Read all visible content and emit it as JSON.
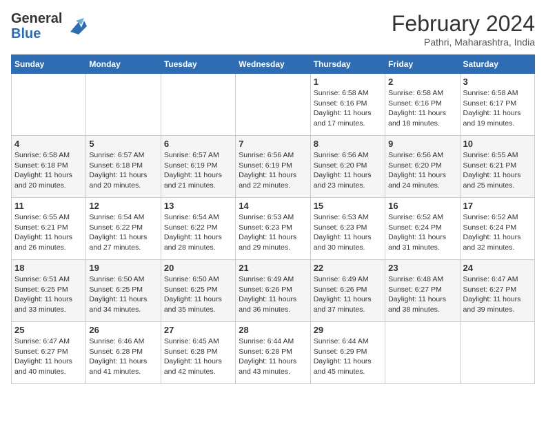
{
  "header": {
    "logo_general": "General",
    "logo_blue": "Blue",
    "month_year": "February 2024",
    "location": "Pathri, Maharashtra, India"
  },
  "days_of_week": [
    "Sunday",
    "Monday",
    "Tuesday",
    "Wednesday",
    "Thursday",
    "Friday",
    "Saturday"
  ],
  "weeks": [
    [
      {
        "num": "",
        "info": ""
      },
      {
        "num": "",
        "info": ""
      },
      {
        "num": "",
        "info": ""
      },
      {
        "num": "",
        "info": ""
      },
      {
        "num": "1",
        "info": "Sunrise: 6:58 AM\nSunset: 6:16 PM\nDaylight: 11 hours and 17 minutes."
      },
      {
        "num": "2",
        "info": "Sunrise: 6:58 AM\nSunset: 6:16 PM\nDaylight: 11 hours and 18 minutes."
      },
      {
        "num": "3",
        "info": "Sunrise: 6:58 AM\nSunset: 6:17 PM\nDaylight: 11 hours and 19 minutes."
      }
    ],
    [
      {
        "num": "4",
        "info": "Sunrise: 6:58 AM\nSunset: 6:18 PM\nDaylight: 11 hours and 20 minutes."
      },
      {
        "num": "5",
        "info": "Sunrise: 6:57 AM\nSunset: 6:18 PM\nDaylight: 11 hours and 20 minutes."
      },
      {
        "num": "6",
        "info": "Sunrise: 6:57 AM\nSunset: 6:19 PM\nDaylight: 11 hours and 21 minutes."
      },
      {
        "num": "7",
        "info": "Sunrise: 6:56 AM\nSunset: 6:19 PM\nDaylight: 11 hours and 22 minutes."
      },
      {
        "num": "8",
        "info": "Sunrise: 6:56 AM\nSunset: 6:20 PM\nDaylight: 11 hours and 23 minutes."
      },
      {
        "num": "9",
        "info": "Sunrise: 6:56 AM\nSunset: 6:20 PM\nDaylight: 11 hours and 24 minutes."
      },
      {
        "num": "10",
        "info": "Sunrise: 6:55 AM\nSunset: 6:21 PM\nDaylight: 11 hours and 25 minutes."
      }
    ],
    [
      {
        "num": "11",
        "info": "Sunrise: 6:55 AM\nSunset: 6:21 PM\nDaylight: 11 hours and 26 minutes."
      },
      {
        "num": "12",
        "info": "Sunrise: 6:54 AM\nSunset: 6:22 PM\nDaylight: 11 hours and 27 minutes."
      },
      {
        "num": "13",
        "info": "Sunrise: 6:54 AM\nSunset: 6:22 PM\nDaylight: 11 hours and 28 minutes."
      },
      {
        "num": "14",
        "info": "Sunrise: 6:53 AM\nSunset: 6:23 PM\nDaylight: 11 hours and 29 minutes."
      },
      {
        "num": "15",
        "info": "Sunrise: 6:53 AM\nSunset: 6:23 PM\nDaylight: 11 hours and 30 minutes."
      },
      {
        "num": "16",
        "info": "Sunrise: 6:52 AM\nSunset: 6:24 PM\nDaylight: 11 hours and 31 minutes."
      },
      {
        "num": "17",
        "info": "Sunrise: 6:52 AM\nSunset: 6:24 PM\nDaylight: 11 hours and 32 minutes."
      }
    ],
    [
      {
        "num": "18",
        "info": "Sunrise: 6:51 AM\nSunset: 6:25 PM\nDaylight: 11 hours and 33 minutes."
      },
      {
        "num": "19",
        "info": "Sunrise: 6:50 AM\nSunset: 6:25 PM\nDaylight: 11 hours and 34 minutes."
      },
      {
        "num": "20",
        "info": "Sunrise: 6:50 AM\nSunset: 6:25 PM\nDaylight: 11 hours and 35 minutes."
      },
      {
        "num": "21",
        "info": "Sunrise: 6:49 AM\nSunset: 6:26 PM\nDaylight: 11 hours and 36 minutes."
      },
      {
        "num": "22",
        "info": "Sunrise: 6:49 AM\nSunset: 6:26 PM\nDaylight: 11 hours and 37 minutes."
      },
      {
        "num": "23",
        "info": "Sunrise: 6:48 AM\nSunset: 6:27 PM\nDaylight: 11 hours and 38 minutes."
      },
      {
        "num": "24",
        "info": "Sunrise: 6:47 AM\nSunset: 6:27 PM\nDaylight: 11 hours and 39 minutes."
      }
    ],
    [
      {
        "num": "25",
        "info": "Sunrise: 6:47 AM\nSunset: 6:27 PM\nDaylight: 11 hours and 40 minutes."
      },
      {
        "num": "26",
        "info": "Sunrise: 6:46 AM\nSunset: 6:28 PM\nDaylight: 11 hours and 41 minutes."
      },
      {
        "num": "27",
        "info": "Sunrise: 6:45 AM\nSunset: 6:28 PM\nDaylight: 11 hours and 42 minutes."
      },
      {
        "num": "28",
        "info": "Sunrise: 6:44 AM\nSunset: 6:28 PM\nDaylight: 11 hours and 43 minutes."
      },
      {
        "num": "29",
        "info": "Sunrise: 6:44 AM\nSunset: 6:29 PM\nDaylight: 11 hours and 45 minutes."
      },
      {
        "num": "",
        "info": ""
      },
      {
        "num": "",
        "info": ""
      }
    ]
  ]
}
